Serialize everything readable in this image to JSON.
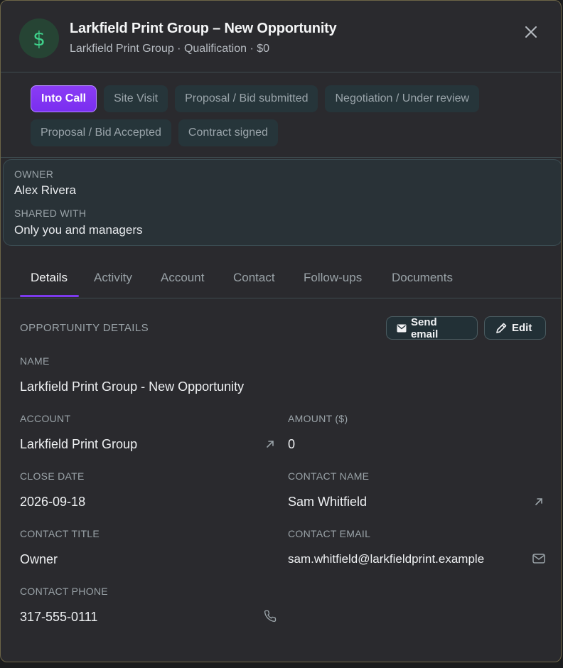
{
  "header": {
    "title": "Larkfield Print Group – New Opportunity",
    "subtitle": "Larkfield Print Group · Qualification · $0",
    "avatar_symbol": "$",
    "avatar_icon": "dollar-icon",
    "close_icon": "close-icon"
  },
  "stages": [
    {
      "label": "Into Call",
      "active": true
    },
    {
      "label": "Site Visit",
      "active": false
    },
    {
      "label": "Proposal / Bid submitted",
      "active": false
    },
    {
      "label": "Negotiation / Under review",
      "active": false
    },
    {
      "label": "Proposal / Bid Accepted",
      "active": false
    },
    {
      "label": "Contract signed",
      "active": false
    }
  ],
  "sharing": {
    "owner_label": "OWNER",
    "owner_value": "Alex Rivera",
    "shared_label": "SHARED WITH",
    "shared_value": "Only you and managers"
  },
  "tabs": [
    "Details",
    "Activity",
    "Account",
    "Contact",
    "Follow-ups",
    "Documents"
  ],
  "details": {
    "section_title": "OPPORTUNITY DETAILS",
    "send_email_label": "Send email",
    "edit_label": "Edit",
    "name_label": "NAME",
    "name_value": "Larkfield Print Group - New Opportunity",
    "account_label": "ACCOUNT",
    "account_value": "Larkfield Print Group",
    "amount_label": "AMOUNT ($)",
    "amount_value": "0",
    "close_date_label": "CLOSE DATE",
    "close_date_value": "2026-09-18",
    "contact_name_label": "CONTACT NAME",
    "contact_name_value": "Sam Whitfield",
    "contact_title_label": "CONTACT TITLE",
    "contact_title_value": "Owner",
    "contact_email_label": "CONTACT EMAIL",
    "contact_email_value": "sam.whitfield@larkfieldprint.example",
    "contact_phone_label": "CONTACT PHONE",
    "contact_phone_value": "317-555-0111"
  },
  "colors": {
    "accent": "#7c3aed",
    "avatar_bg": "#264434",
    "avatar_fg": "#3fd08a",
    "panel_bg": "#2a2a2e"
  }
}
